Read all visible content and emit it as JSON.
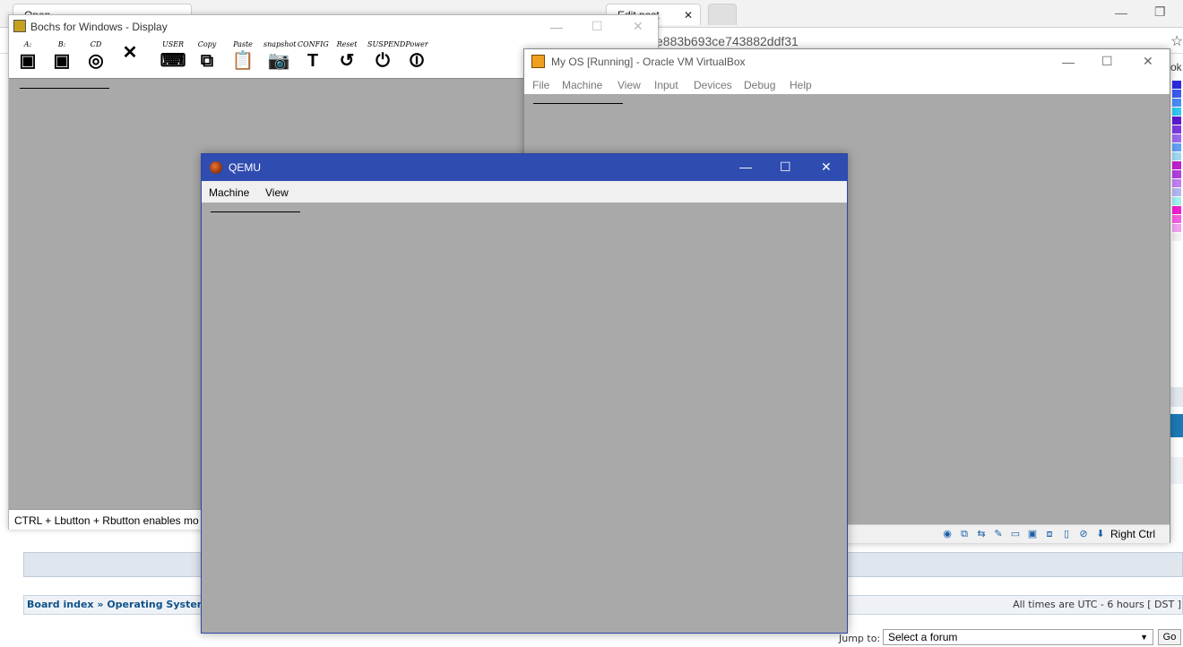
{
  "browser": {
    "tab_open_label": "Open",
    "tab_edit_label": "Edit post",
    "tab_close_glyph": "✕",
    "url_fragment": "e883b693ce743882ddf31",
    "star_icon": "☆",
    "right_text": "ok",
    "minimize_glyph": "—",
    "restore_glyph": "❐"
  },
  "forum": {
    "board_index": "Board index",
    "breadcrumb_sep": "»",
    "section": "Operating System D",
    "times_note": "All times are UTC - 6 hours [ DST ]",
    "jump_label": "Jump to:",
    "select_value": "Select a forum",
    "go_label": "Go",
    "palette_colors": [
      "#2a2ae0",
      "#3a5cf0",
      "#4a8cf8",
      "#30c8f0",
      "#5a1ad0",
      "#7a3ae0",
      "#9a6af0",
      "#60a0f8",
      "#a0d8f0",
      "#c020d0",
      "#b040e0",
      "#c080f0",
      "#b0b8f0",
      "#a0f0f0",
      "#f020d0",
      "#f060e0",
      "#f0a0f0",
      "#f0f0f0"
    ]
  },
  "bochs": {
    "title": "Bochs for Windows - Display",
    "toolbar": [
      {
        "name": "floppy-a",
        "label": "A:",
        "glyph": "▣"
      },
      {
        "name": "floppy-b",
        "label": "B:",
        "glyph": "▣"
      },
      {
        "name": "cdrom",
        "label": "CD",
        "glyph": "◎"
      },
      {
        "name": "mouse",
        "label": "",
        "glyph": "✕"
      },
      {
        "name": "user",
        "label": "USER",
        "glyph": "⌨"
      },
      {
        "name": "copy",
        "label": "Copy",
        "glyph": "⧉"
      },
      {
        "name": "paste",
        "label": "Paste",
        "glyph": "📋"
      },
      {
        "name": "snapshot",
        "label": "snapshot",
        "glyph": "📷"
      },
      {
        "name": "config",
        "label": "CONFIG",
        "glyph": "T"
      },
      {
        "name": "reset",
        "label": "Reset",
        "glyph": "↺"
      },
      {
        "name": "suspend",
        "label": "SUSPEND",
        "glyph": "⏻"
      },
      {
        "name": "power",
        "label": "Power",
        "glyph": "⏼"
      }
    ],
    "status_text": "CTRL + Lbutton + Rbutton enables mo"
  },
  "vbox": {
    "title": "My OS [Running] - Oracle VM VirtualBox",
    "menu": [
      "File",
      "Machine",
      "View",
      "Input",
      "Devices",
      "Debug",
      "Help"
    ],
    "minimize_glyph": "—",
    "maximize_glyph": "☐",
    "close_glyph": "✕",
    "status_icons": [
      "◉",
      "⧉",
      "⇆",
      "✎",
      "▭",
      "▣",
      "⧈",
      "▯",
      "⊘",
      "⬇"
    ],
    "host_key": "Right Ctrl"
  },
  "qemu": {
    "title": "QEMU",
    "menu": [
      "Machine",
      "View"
    ],
    "minimize_glyph": "—",
    "maximize_glyph": "☐",
    "close_glyph": "✕"
  }
}
